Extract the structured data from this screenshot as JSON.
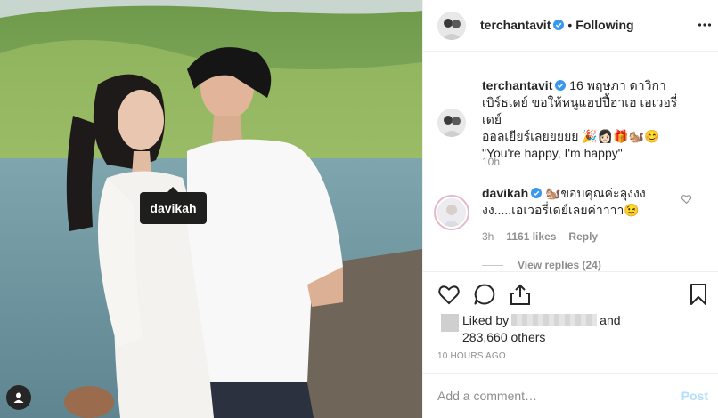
{
  "photo": {
    "tag_label": "davikah"
  },
  "header": {
    "username": "terchantavit",
    "separator": "•",
    "follow_status": "Following"
  },
  "caption": {
    "username": "terchantavit",
    "text_line1": "16 พฤษภา ดาวิกา",
    "text_line2": "เบิร์ธเดย์ ขอให้หนูแฮปปี้ฮาเฮ เอเวอรี่เดย์",
    "text_line3": "ออลเยียร์เลยยยยย 🎉👩🏻🎁🐿️😊",
    "text_line4": "\"You're happy, I'm happy\"",
    "time": "10h"
  },
  "reply_comment": {
    "username": "davikah",
    "text": "🐿️ขอบคุณค่ะลุงงง งง.....เอเวอรี่เดย์เลยค่าาาา😉",
    "time": "3h",
    "likes": "1161 likes",
    "reply_label": "Reply",
    "view_replies": "View replies (24)"
  },
  "likes": {
    "prefix": "Liked by",
    "and": "and",
    "count": "283,660 others"
  },
  "timestamp": "10 HOURS AGO",
  "add_comment": {
    "placeholder": "Add a comment…",
    "post_label": "Post"
  },
  "colors": {
    "accent": "#0095f6",
    "post_disabled": "#b2dffc",
    "muted": "#8e8e8e",
    "verified": "#3897f0"
  },
  "icons": [
    "more-icon",
    "verified-icon",
    "heart-icon",
    "comment-icon",
    "share-icon",
    "bookmark-icon",
    "user-tag-icon"
  ]
}
